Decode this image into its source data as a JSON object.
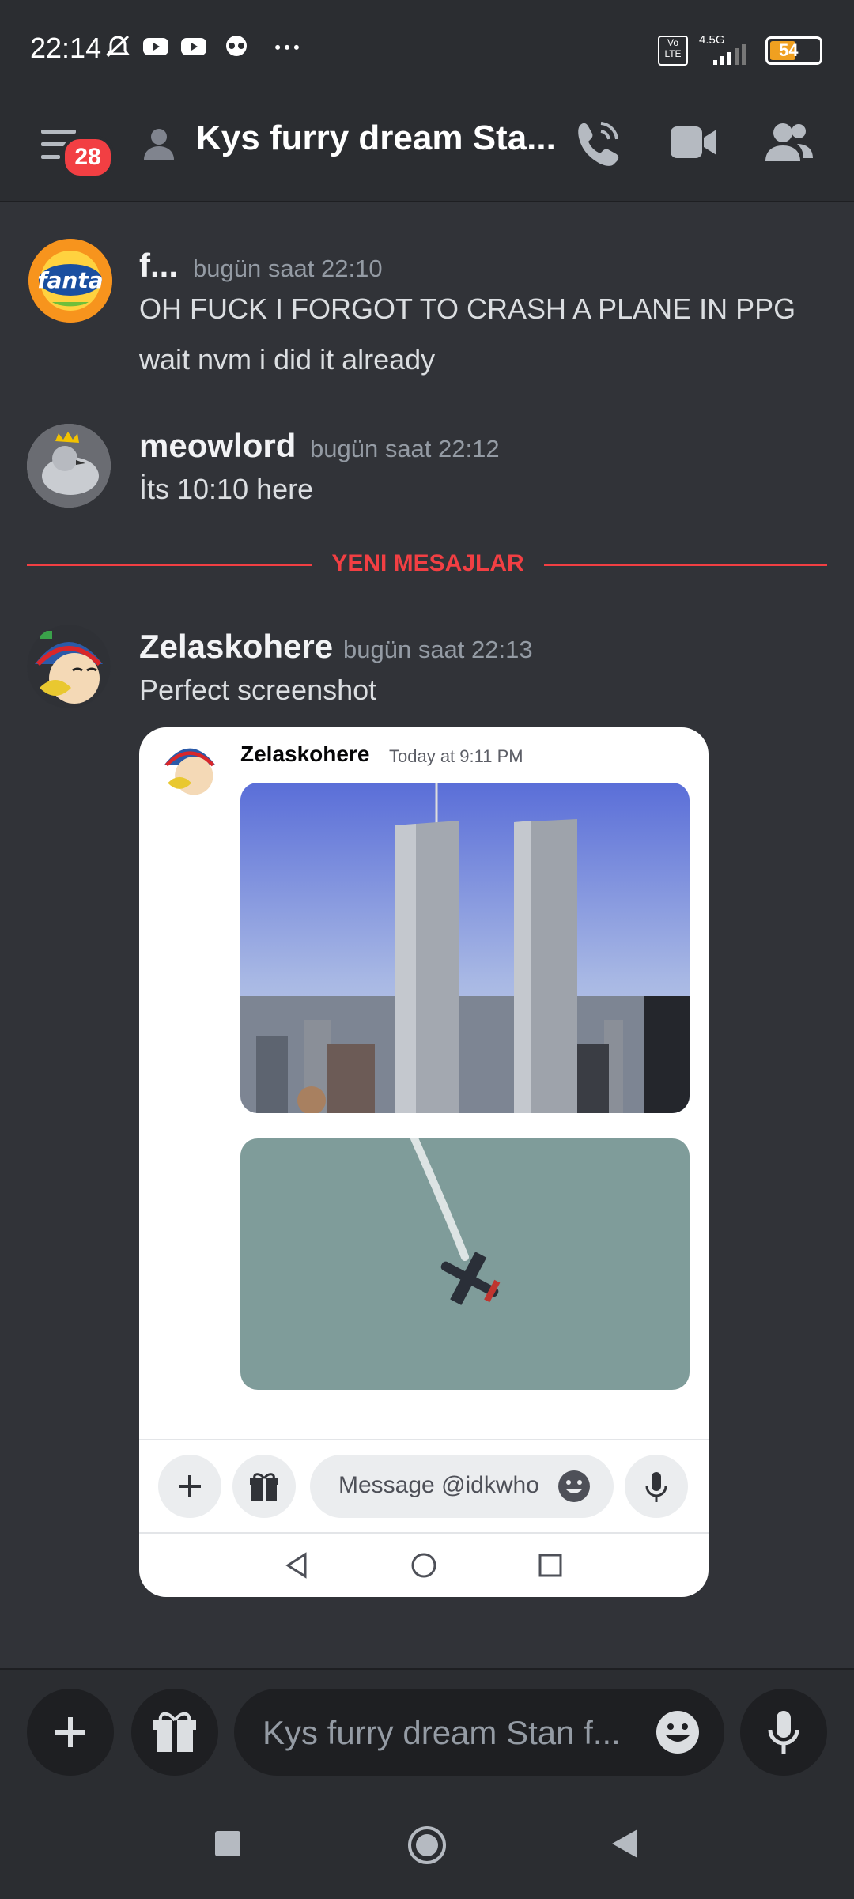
{
  "status_bar": {
    "time": "22:14",
    "network": "4.5G",
    "volte": "Vo LTE",
    "battery": "54"
  },
  "header": {
    "unread_count": "28",
    "title": "Kys furry dream Sta..."
  },
  "messages": [
    {
      "author": "f...",
      "timestamp": "bugün saat 22:10",
      "lines": [
        "OH FUCK I FORGOT TO CRASH A PLANE IN PPG",
        "wait nvm i did it already"
      ]
    },
    {
      "author": "meowlord",
      "timestamp": "bugün saat 22:12",
      "lines": [
        "İts 10:10 here"
      ]
    },
    {
      "author": "Zelaskohere",
      "timestamp": "bugün saat 22:13",
      "lines": [
        "Perfect screenshot"
      ]
    }
  ],
  "new_messages_divider": "YENI MESAJLAR",
  "attachment": {
    "author": "Zelaskohere",
    "timestamp": "Today at 9:11 PM",
    "input_placeholder": "Message @idkwho"
  },
  "composer": {
    "placeholder": "Kys furry dream Stan f..."
  },
  "colors": {
    "background": "#313338",
    "header": "#2b2d31",
    "accent_red": "#f23f43"
  }
}
